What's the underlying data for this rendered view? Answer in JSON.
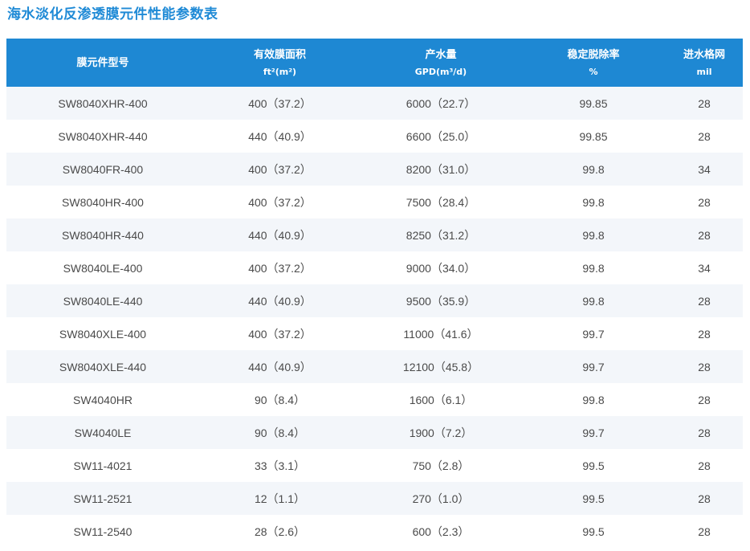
{
  "page": {
    "title": "海水淡化反渗透膜元件性能参数表",
    "accent_color": "#1e88d3",
    "title_color": "#1f8ad6"
  },
  "table": {
    "headers": [
      {
        "line1": "膜元件型号",
        "line2": ""
      },
      {
        "line1": "有效膜面积",
        "line2": "ft²(m²)"
      },
      {
        "line1": "产水量",
        "line2": "GPD(m³/d)"
      },
      {
        "line1": "稳定脱除率",
        "line2": "%"
      },
      {
        "line1": "进水格网",
        "line2": "mil"
      }
    ],
    "rows": [
      [
        "SW8040XHR-400",
        "400（37.2）",
        "6000（22.7）",
        "99.85",
        "28"
      ],
      [
        "SW8040XHR-440",
        "440（40.9）",
        "6600（25.0）",
        "99.85",
        "28"
      ],
      [
        "SW8040FR-400",
        "400（37.2）",
        "8200（31.0）",
        "99.8",
        "34"
      ],
      [
        "SW8040HR-400",
        "400（37.2）",
        "7500（28.4）",
        "99.8",
        "28"
      ],
      [
        "SW8040HR-440",
        "440（40.9）",
        "8250（31.2）",
        "99.8",
        "28"
      ],
      [
        "SW8040LE-400",
        "400（37.2）",
        "9000（34.0）",
        "99.8",
        "34"
      ],
      [
        "SW8040LE-440",
        "440（40.9）",
        "9500（35.9）",
        "99.8",
        "28"
      ],
      [
        "SW8040XLE-400",
        "400（37.2）",
        "11000（41.6）",
        "99.7",
        "28"
      ],
      [
        "SW8040XLE-440",
        "440（40.9）",
        "12100（45.8）",
        "99.7",
        "28"
      ],
      [
        "SW4040HR",
        "90（8.4）",
        "1600（6.1）",
        "99.8",
        "28"
      ],
      [
        "SW4040LE",
        "90（8.4）",
        "1900（7.2）",
        "99.7",
        "28"
      ],
      [
        "SW11-4021",
        "33（3.1）",
        "750（2.8）",
        "99.5",
        "28"
      ],
      [
        "SW11-2521",
        "12（1.1）",
        "270（1.0）",
        "99.5",
        "28"
      ],
      [
        "SW11-2540",
        "28（2.6）",
        "600（2.3）",
        "99.5",
        "28"
      ]
    ]
  }
}
